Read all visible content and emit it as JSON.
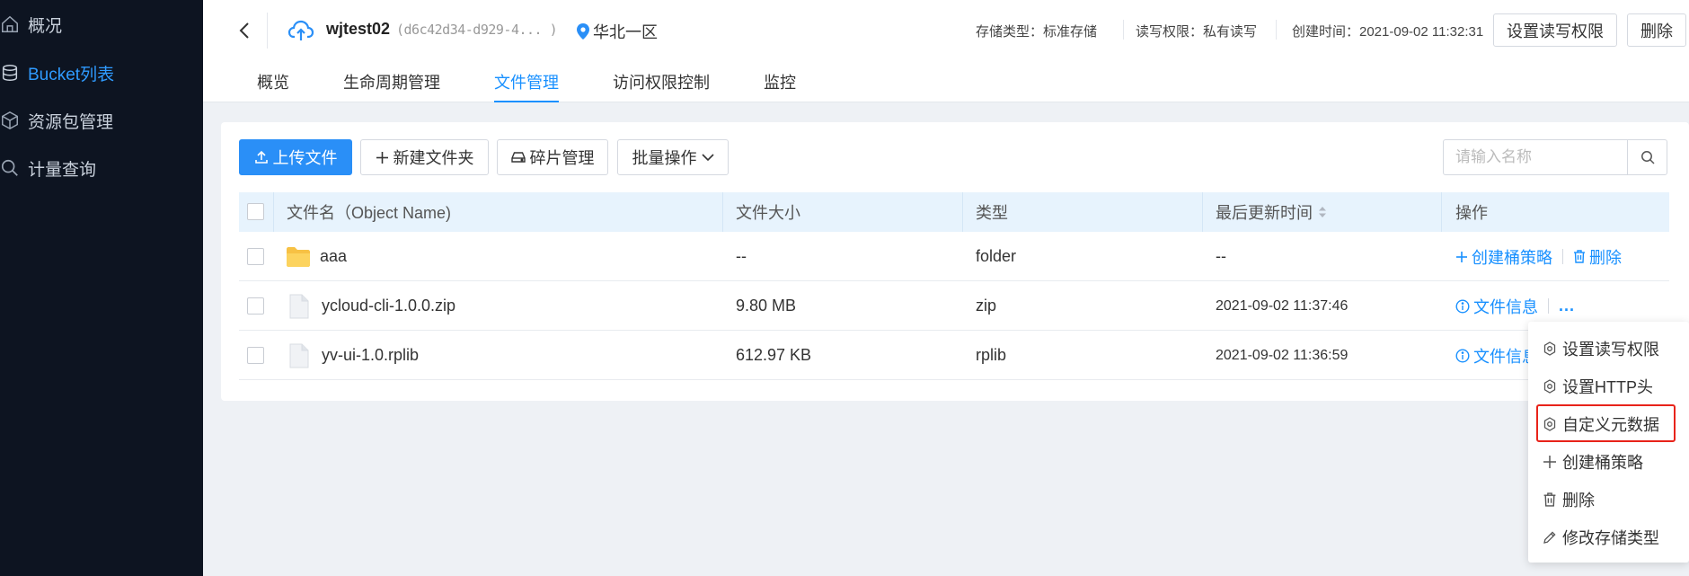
{
  "sidebar": {
    "items": [
      {
        "label": "概况",
        "icon": "home-icon"
      },
      {
        "label": "Bucket列表",
        "icon": "database-icon",
        "active": true
      },
      {
        "label": "资源包管理",
        "icon": "package-icon"
      },
      {
        "label": "计量查询",
        "icon": "search-icon"
      }
    ]
  },
  "header": {
    "bucket_name": "wjtest02",
    "bucket_id": "(d6c42d34-d929-4... )",
    "region": "华北一区",
    "storage_type": "存储类型：标准存储",
    "rw_permission": "读写权限：私有读写",
    "created_time": "创建时间：2021-09-02 11:32:31",
    "set_permission_button": "设置读写权限",
    "delete_button": "删除"
  },
  "tabs": [
    {
      "label": "概览"
    },
    {
      "label": "生命周期管理"
    },
    {
      "label": "文件管理",
      "active": true
    },
    {
      "label": "访问权限控制"
    },
    {
      "label": "监控"
    }
  ],
  "toolbar": {
    "upload": "上传文件",
    "new_folder": "新建文件夹",
    "fragments": "碎片管理",
    "batch": "批量操作",
    "search_placeholder": "请输入名称"
  },
  "table": {
    "columns": [
      "文件名（Object Name)",
      "文件大小",
      "类型",
      "最后更新时间",
      "操作"
    ],
    "rows": [
      {
        "name": "aaa",
        "size": "--",
        "type": "folder",
        "updated": "--",
        "kind": "folder",
        "op1": "创建桶策略",
        "op2": "删除"
      },
      {
        "name": "ycloud-cli-1.0.0.zip",
        "size": "9.80 MB",
        "type": "zip",
        "updated": "2021-09-02 11:37:46",
        "kind": "file",
        "op1": "文件信息",
        "op2": "..."
      },
      {
        "name": "yv-ui-1.0.rplib",
        "size": "612.97 KB",
        "type": "rplib",
        "updated": "2021-09-02 11:36:59",
        "kind": "file",
        "op1": "文件信息",
        "op2": ""
      }
    ]
  },
  "dropdown": {
    "items": [
      {
        "label": "设置读写权限",
        "icon": "gear-icon"
      },
      {
        "label": "设置HTTP头",
        "icon": "gear-icon"
      },
      {
        "label": "自定义元数据",
        "icon": "gear-icon",
        "highlighted": true
      },
      {
        "label": "创建桶策略",
        "icon": "plus-icon"
      },
      {
        "label": "删除",
        "icon": "trash-icon"
      },
      {
        "label": "修改存储类型",
        "icon": "edit-icon"
      }
    ]
  },
  "colors": {
    "accent": "#1890ff",
    "sidebar_bg": "#0d1421",
    "highlight_border": "#e8231a"
  }
}
